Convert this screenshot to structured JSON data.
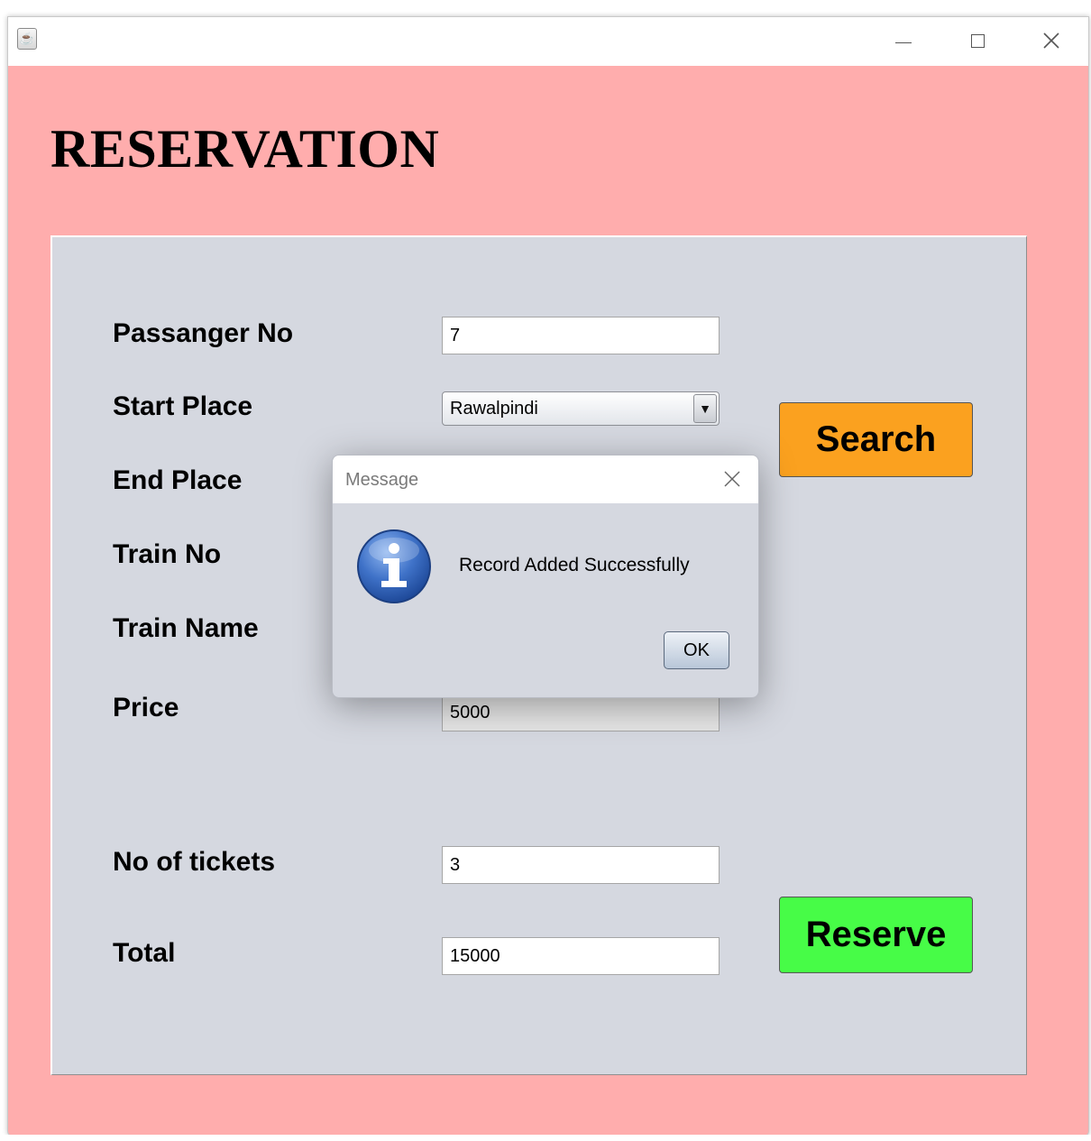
{
  "window": {
    "title": ""
  },
  "page": {
    "heading": "RESERVATION"
  },
  "form": {
    "passenger_no_label": "Passanger No",
    "passenger_no_value": "7",
    "start_place_label": "Start Place",
    "start_place_value": "Rawalpindi",
    "end_place_label": "End Place",
    "train_no_label": "Train No",
    "train_name_label": "Train Name",
    "price_label": "Price",
    "price_value": "5000",
    "tickets_label": "No of tickets",
    "tickets_value": "3",
    "total_label": "Total",
    "total_value": "15000",
    "search_label": "Search",
    "reserve_label": "Reserve"
  },
  "dialog": {
    "title": "Message",
    "message": "Record Added Successfully",
    "ok_label": "OK",
    "icon": "info-icon"
  },
  "colors": {
    "window_background": "#ffadad",
    "panel_background": "#d5d8e0",
    "search_button": "#fba11f",
    "reserve_button": "#47fc47"
  }
}
